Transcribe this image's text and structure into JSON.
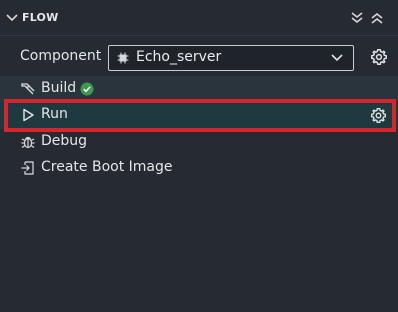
{
  "panel": {
    "title": "FLOW"
  },
  "component": {
    "label": "Component",
    "selected": "Echo_server"
  },
  "flow_items": [
    {
      "label": "Build",
      "status": "success",
      "icon": "hammer-icon"
    },
    {
      "label": "Run",
      "icon": "play-icon"
    },
    {
      "label": "Debug",
      "icon": "bug-icon"
    },
    {
      "label": "Create Boot Image",
      "icon": "boot-image-icon"
    }
  ],
  "colors": {
    "background": "#252a33",
    "selected_row": "#1e3a40",
    "highlight": "#d6252c",
    "success": "#3a9a4a"
  }
}
